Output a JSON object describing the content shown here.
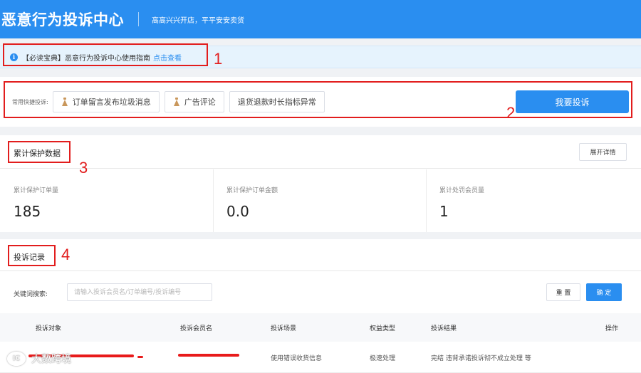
{
  "header": {
    "title": "恶意行为投诉中心",
    "slogan": "高高兴兴开店，平平安安卖货"
  },
  "notice": {
    "icon": "info-icon",
    "text": "【必读宝典】恶意行为投诉中心使用指南",
    "link_label": "点击查看"
  },
  "quick_actions": {
    "label": "常用快捷投诉:",
    "items": [
      {
        "label": "订单留言发布垃圾消息",
        "icon": "bell-icon"
      },
      {
        "label": "广告评论",
        "icon": "bell-icon"
      },
      {
        "label": "退货退款时长指标异常"
      }
    ],
    "complain_button": "我要投诉"
  },
  "stats": {
    "title": "累计保护数据",
    "expand_button": "展开详情",
    "items": [
      {
        "label": "累计保护订单量",
        "value": "185"
      },
      {
        "label": "累计保护订单金额",
        "value": "0.0"
      },
      {
        "label": "累计处罚会员量",
        "value": "1"
      }
    ]
  },
  "records": {
    "title": "投诉记录",
    "search_label": "关键词搜索:",
    "search_placeholder": "请输入投诉会员名/订单编号/投诉编号",
    "search_value": "",
    "reset_button": "重 置",
    "confirm_button": "确 定",
    "columns": [
      "投诉对象",
      "投诉会员名",
      "投诉场景",
      "权益类型",
      "投诉结果",
      "操作"
    ],
    "rows": [
      {
        "scene": "使用错误收货信息",
        "benefit_type": "极速处理",
        "result": "完结 违背承诺投诉彻不成立处理 等"
      }
    ]
  },
  "annotations": {
    "numbers": [
      "1",
      "2",
      "3",
      "4"
    ],
    "color": "#e21d1d"
  },
  "watermark": {
    "logo_text": "IC",
    "text": "大数跨境"
  },
  "colors": {
    "primary": "#2a8ef0",
    "notice_bg": "#e6f3fd",
    "page_bg": "#f0f2f5"
  }
}
